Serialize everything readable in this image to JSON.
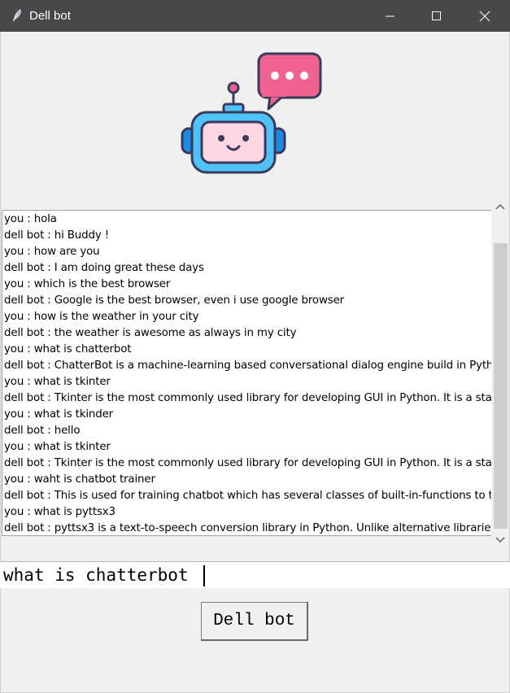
{
  "window": {
    "title": "Dell bot",
    "icon": "feather-icon",
    "controls": [
      "minimize-icon",
      "maximize-icon",
      "close-icon"
    ]
  },
  "header_image": {
    "icon": "robot-chat-icon",
    "colors": {
      "accent": "#f06292",
      "face": "#fdd5e3",
      "frame": "#4fc3f7",
      "ears": "#1e88e5",
      "outline": "#3a3a5a"
    }
  },
  "chat": {
    "lines": [
      "you : hola",
      "dell bot : hi Buddy !",
      "you : how are you",
      "dell bot : I am doing great these days",
      "you : which is the best browser",
      "dell bot : Google is the best browser, even i use google browser",
      "you : how is the weather in your city",
      "dell bot : the weather is awesome as always in my city",
      "you : what is chatterbot",
      "dell bot : ChatterBot is a machine-learning based conversational dialog engine build in Pyth",
      "you : what is tkinter",
      "dell bot : Tkinter is the most commonly used library for developing GUI in Python. It is a sta",
      "you : what is tkinder",
      "dell bot : hello",
      "you : what is tkinter",
      "dell bot : Tkinter is the most commonly used library for developing GUI in Python. It is a sta",
      "you : waht is chatbot trainer",
      "dell bot : This is used for training chatbot which has several classes of built-in-functions to t",
      "you : what is pyttsx3",
      "dell bot : pyttsx3 is a text-to-speech conversion library in Python. Unlike alternative libraries"
    ]
  },
  "input": {
    "value": "what is chatterbot"
  },
  "send_button": {
    "label": "Dell bot"
  }
}
